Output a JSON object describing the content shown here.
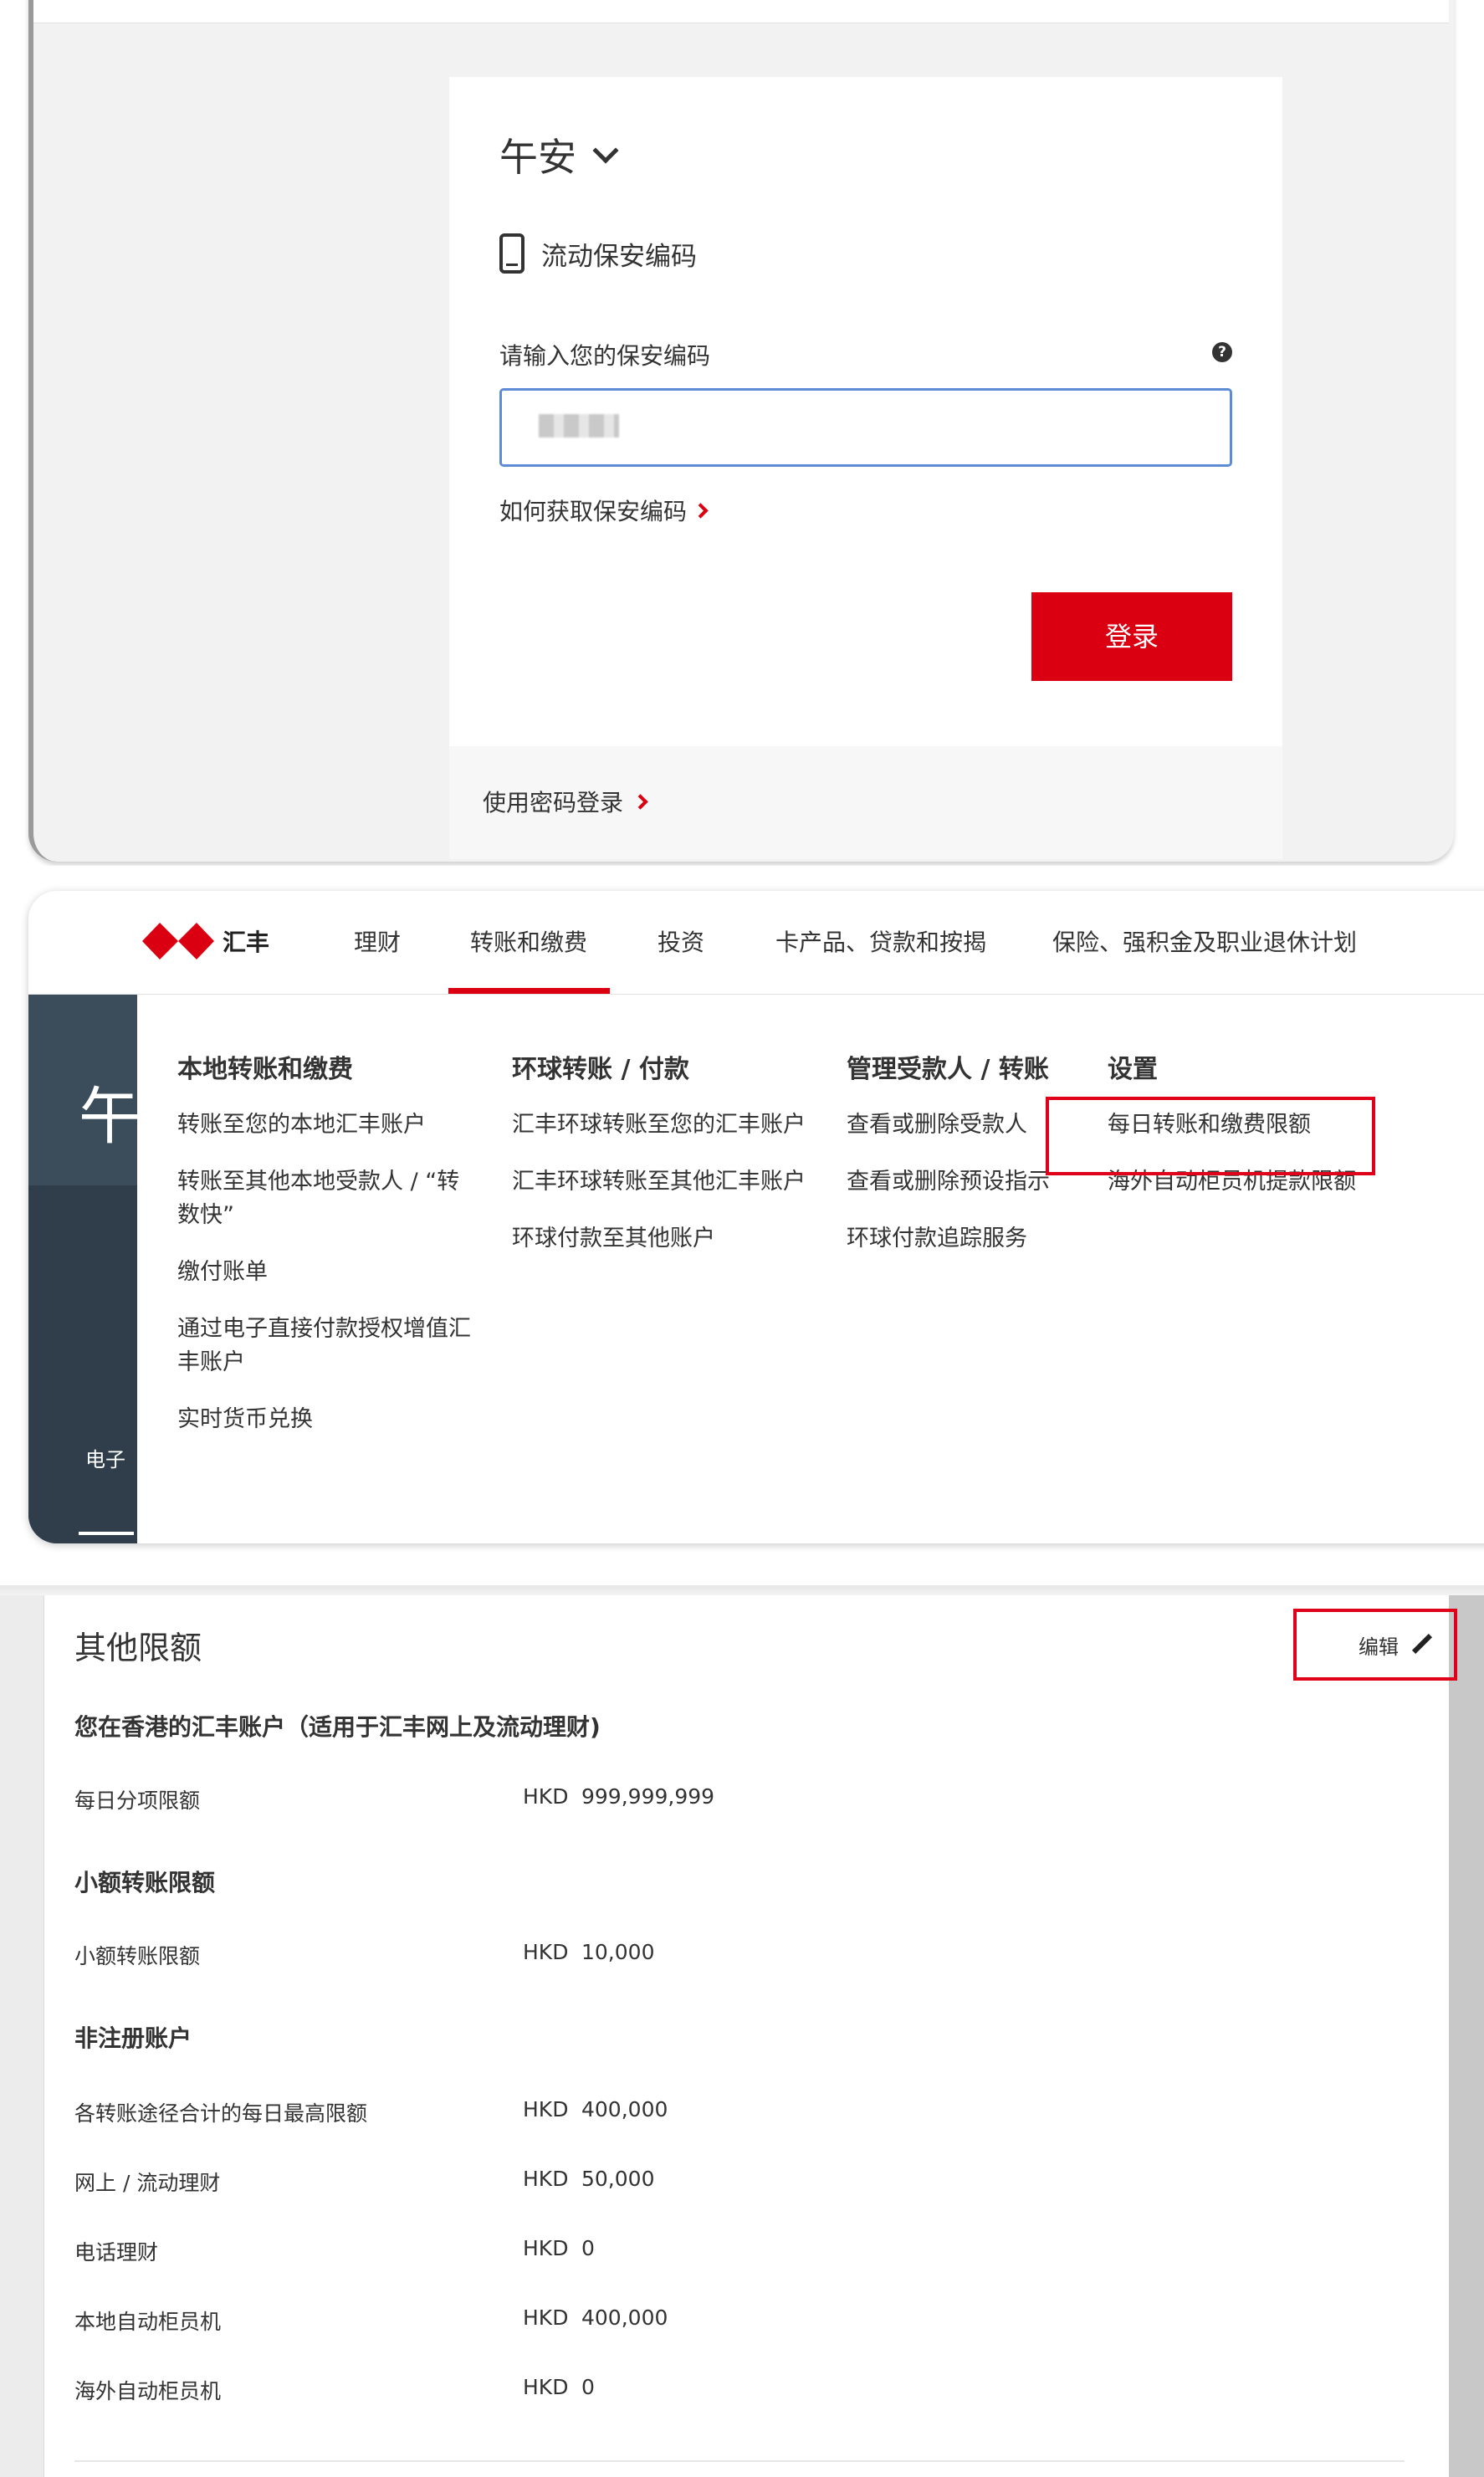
{
  "login": {
    "greeting": "午安",
    "method_label": "流动保安编码",
    "code_label": "请输入您的保安编码",
    "help_icon": "?",
    "how_to_link": "如何获取保安编码",
    "login_button": "登录",
    "password_login_link": "使用密码登录"
  },
  "nav": {
    "logo_label": "汇丰",
    "items": [
      "理财",
      "转账和缴费",
      "投资",
      "卡产品、贷款和按揭",
      "保险、强积金及职业退休计划"
    ],
    "active_index": 1
  },
  "background": {
    "big_char": "午",
    "side_text": "电子"
  },
  "menu": {
    "columns": [
      {
        "heading": "本地转账和缴费",
        "items": [
          "转账至您的本地汇丰账户",
          "转账至其他本地受款人 / “转数快”",
          "缴付账单",
          "通过电子直接付款授权增值汇丰账户",
          "实时货币兑换"
        ]
      },
      {
        "heading": "环球转账 / 付款",
        "items": [
          "汇丰环球转账至您的汇丰账户",
          "汇丰环球转账至其他汇丰账户",
          "环球付款至其他账户"
        ]
      },
      {
        "heading": "管理受款人 / 转账",
        "items": [
          "查看或删除受款人",
          "查看或删除预设指示",
          "环球付款追踪服务"
        ]
      },
      {
        "heading": "设置",
        "items": [
          "每日转账和缴费限额",
          "海外自动柜员机提款限额"
        ]
      }
    ]
  },
  "limits": {
    "title": "其他限额",
    "edit_label": "编辑",
    "account_heading": "您在香港的汇丰账户（适用于汇丰网上及流动理财)",
    "daily": {
      "label": "每日分项限额",
      "currency": "HKD",
      "amount": "999,999,999"
    },
    "small_heading": "小额转账限额",
    "small": {
      "label": "小额转账限额",
      "currency": "HKD",
      "amount": "10,000"
    },
    "unregistered_heading": "非注册账户",
    "rows": [
      {
        "label": "各转账途径合计的每日最高限额",
        "currency": "HKD",
        "amount": "400,000"
      },
      {
        "label": "网上 / 流动理财",
        "currency": "HKD",
        "amount": "50,000"
      },
      {
        "label": "电话理财",
        "currency": "HKD",
        "amount": "0"
      },
      {
        "label": "本地自动柜员机",
        "currency": "HKD",
        "amount": "400,000"
      },
      {
        "label": "海外自动柜员机",
        "currency": "HKD",
        "amount": "0"
      }
    ]
  },
  "colors": {
    "brand_red": "#db0011",
    "highlight_red": "#e0001a",
    "input_border": "#5d8bd6"
  }
}
